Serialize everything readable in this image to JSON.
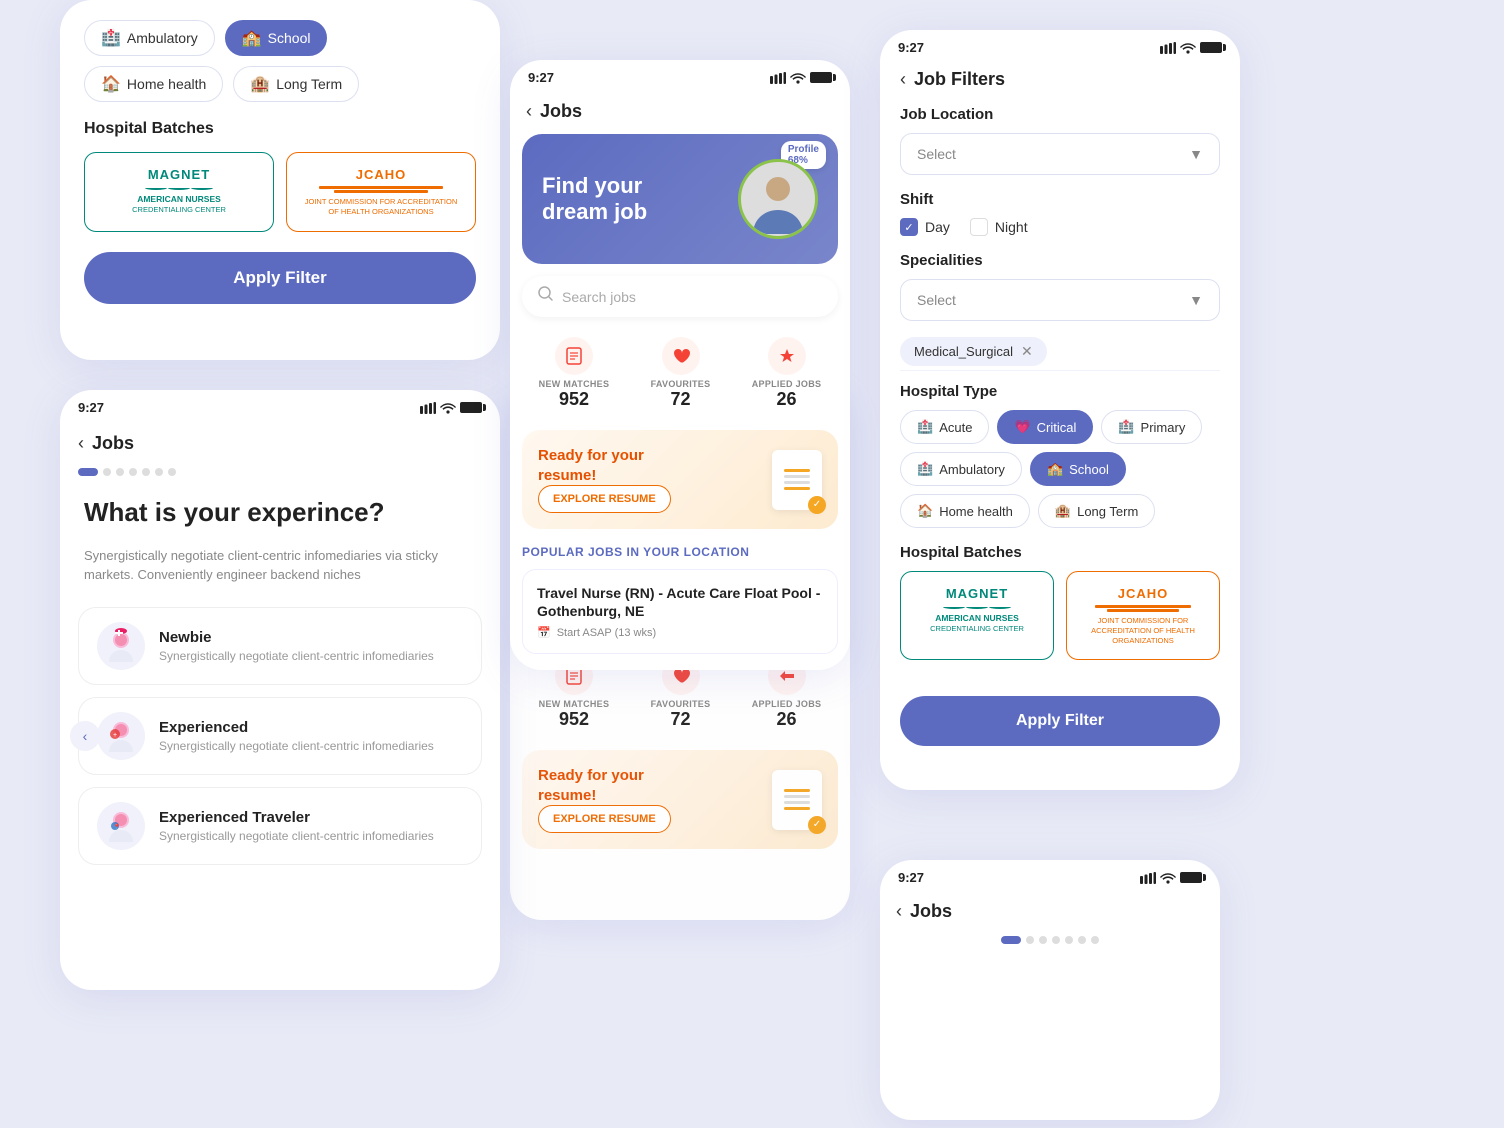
{
  "card1": {
    "tags": [
      {
        "label": "Ambulatory",
        "icon": "🏥",
        "active": false
      },
      {
        "label": "School",
        "icon": "🏫",
        "active": true
      },
      {
        "label": "Home health",
        "icon": "🏠",
        "active": false
      },
      {
        "label": "Long Term",
        "icon": "🏨",
        "active": false
      }
    ],
    "section_title": "Hospital Batches",
    "batch1_title": "MAGNET",
    "batch1_subtitle": "AMERICAN NURSES",
    "batch1_desc": "CREDENTIALING CENTER",
    "batch2_title": "JCAHO",
    "batch2_desc": "JOINT COMMISSION FOR ACCREDITATION OF HEALTH ORGANIZATIONS",
    "apply_btn": "Apply Filter"
  },
  "card2": {
    "time": "9:27",
    "back_label": "Jobs",
    "question": "What is your experince?",
    "sub": "Synergistically negotiate client-centric infomediaries via sticky markets. Conveniently engineer backend niches",
    "experiences": [
      {
        "name": "Newbie",
        "desc": "Synergistically negotiate client-centric infomediaries",
        "icon": "👩‍⚕️"
      },
      {
        "name": "Experienced",
        "desc": "Synergistically negotiate client-centric infomediaries",
        "icon": "👩‍⚕️"
      },
      {
        "name": "Experienced Traveler",
        "desc": "Synergistically negotiate client-centric infomediaries",
        "icon": "👩‍⚕️"
      }
    ]
  },
  "card3": {
    "time": "9:27",
    "back_label": "Jobs",
    "banner_text": "Find your dream job",
    "profile_label": "Profile",
    "profile_pct": "68%",
    "search_placeholder": "Search jobs",
    "stats": [
      {
        "label": "NEW MATCHES",
        "num": "952",
        "icon": "📋"
      },
      {
        "label": "FAVOURITES",
        "num": "72",
        "icon": "♥"
      },
      {
        "label": "APPLIED JOBS",
        "num": "26",
        "icon": "✈"
      }
    ],
    "resume_text": "Ready for your resume!",
    "explore_btn": "EXPLORE RESUME",
    "popular_label": "POPULAR JOBS IN YOUR LOCATION",
    "jobs": [
      {
        "title": "Travel Nurse (RN) - Acute Care Float Pool - Gothenburg, NE",
        "meta": "Start ASAP  (13 wks)"
      }
    ]
  },
  "card4": {
    "time": "9:27",
    "back_label": "Job Filters",
    "location_label": "Job Location",
    "location_placeholder": "Select",
    "shift_label": "Shift",
    "shift_day": "Day",
    "shift_night": "Night",
    "day_checked": true,
    "night_checked": false,
    "specialities_label": "Specialities",
    "specialities_placeholder": "Select",
    "specialty_chip": "Medical_Surgical",
    "hospital_type_label": "Hospital Type",
    "hospital_types": [
      {
        "label": "Acute",
        "icon": "🏥",
        "active": false
      },
      {
        "label": "Critical",
        "icon": "💗",
        "active": true
      },
      {
        "label": "Primary",
        "icon": "🏥",
        "active": false
      },
      {
        "label": "Ambulatory",
        "icon": "🏥",
        "active": false
      },
      {
        "label": "School",
        "icon": "🏫",
        "active": true
      },
      {
        "label": "Home health",
        "icon": "🏠",
        "active": false
      },
      {
        "label": "Long Term",
        "icon": "🏨",
        "active": false
      }
    ],
    "batches_label": "Hospital Batches",
    "batch1_title": "MAGNET",
    "batch1_subtitle": "AMERICAN NURSES",
    "batch1_desc": "CREDENTIALING CENTER",
    "batch2_title": "JCAHO",
    "batch2_desc": "JOINT COMMISSION FOR ACCREDITATION OF HEALTH ORGANIZATIONS",
    "apply_btn": "Apply Filter"
  },
  "card5": {
    "time": "9:27",
    "back_label": "Jobs",
    "dots": 7
  }
}
